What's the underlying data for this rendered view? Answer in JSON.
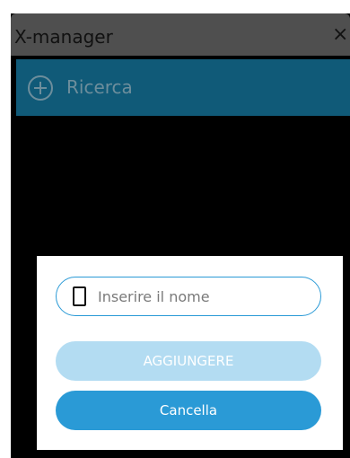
{
  "app": {
    "title": "X-manager",
    "close_glyph": "×"
  },
  "search": {
    "icon": "plus-circle-icon",
    "label": "Ricerca"
  },
  "dialog": {
    "name_field": {
      "icon": "phone-icon",
      "value": "",
      "placeholder": "Inserire il nome"
    },
    "add_button": {
      "label": "AGGIUNGERE",
      "enabled": false
    },
    "cancel_button": {
      "label": "Cancella"
    }
  },
  "colors": {
    "screen_background": "#000000",
    "titlebar": "#4f4f4f",
    "search_bar": "#105a78",
    "search_text": "#6d8e9c",
    "accent": "#2a9ad6",
    "disabled_button": "#b3dcf2"
  }
}
